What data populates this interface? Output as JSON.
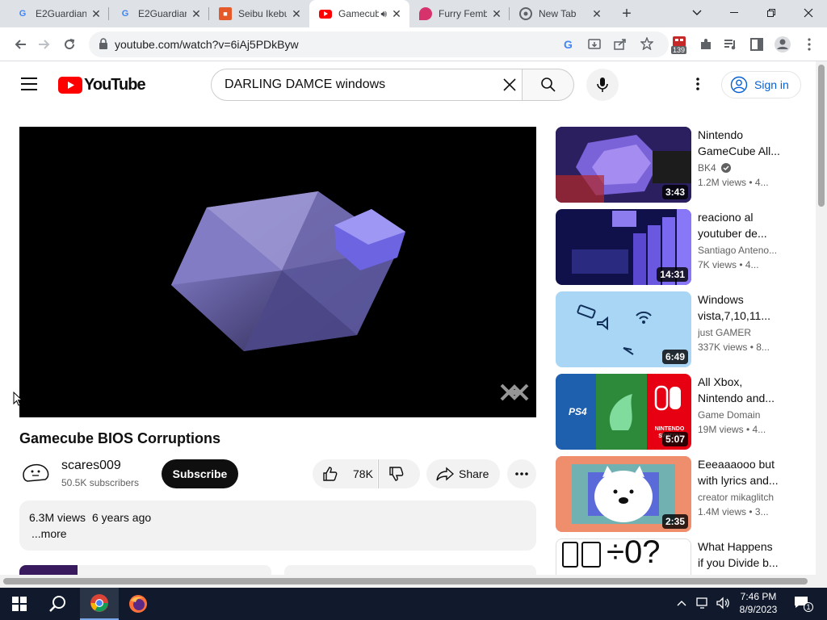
{
  "browser": {
    "tabs": [
      {
        "label": "E2Guardian",
        "icon": "google-g"
      },
      {
        "label": "E2Guardian",
        "icon": "google-g"
      },
      {
        "label": "Seibu Ikebukuro",
        "icon": "site-favicon"
      },
      {
        "label": "Gamecube BIOS Corruptions",
        "icon": "youtube-favicon",
        "active": true
      },
      {
        "label": "Furry Femboy",
        "icon": "site-favicon"
      },
      {
        "label": "New Tab",
        "icon": "chrome-favicon"
      }
    ],
    "url": "youtube.com/watch?v=6iAj5PDkByw",
    "extension_badge": "139"
  },
  "youtube": {
    "logo_text": "YouTube",
    "search_query": "DARLING DAMCE windows",
    "signin_label": "Sign in"
  },
  "video": {
    "title": "Gamecube BIOS Corruptions",
    "channel": "scares009",
    "subscribers": "50.5K subscribers",
    "subscribe_label": "Subscribe",
    "likes": "78K",
    "share_label": "Share",
    "views": "6.3M views",
    "age": "6 years ago",
    "more_label": "...more"
  },
  "recommendations": [
    {
      "title": "Nintendo GameCube All...",
      "channel": "BK4",
      "verified": true,
      "meta": "1.2M views • 4...",
      "duration": "3:43"
    },
    {
      "title": "reaciono al youtuber de...",
      "channel": "Santiago Anteno...",
      "meta": "7K views • 4...",
      "duration": "14:31"
    },
    {
      "title": "Windows vista,7,10,11...",
      "channel": "just GAMER",
      "meta": "337K views • 8...",
      "duration": "6:49"
    },
    {
      "title": "All Xbox, Nintendo and...",
      "channel": "Game Domain",
      "meta": "19M views • 4...",
      "duration": "5:07"
    },
    {
      "title": "Eeeaaaooo but with lyrics and...",
      "channel": "creator mikaglitch",
      "meta": "1.4M views • 3...",
      "duration": "2:35"
    },
    {
      "title": "What Happens if you Divide b...",
      "channel": "",
      "meta": "",
      "duration": ""
    }
  ],
  "thumb_text": {
    "ps4": "PS4",
    "switch": "NINTENDO SWITCH",
    "divide": "÷0?"
  },
  "taskbar": {
    "time": "7:46 PM",
    "date": "8/9/2023",
    "notification_count": "1"
  },
  "colors": {
    "youtube_red": "#ff0000",
    "link_blue": "#065fd4",
    "taskbar": "#101a2c"
  }
}
